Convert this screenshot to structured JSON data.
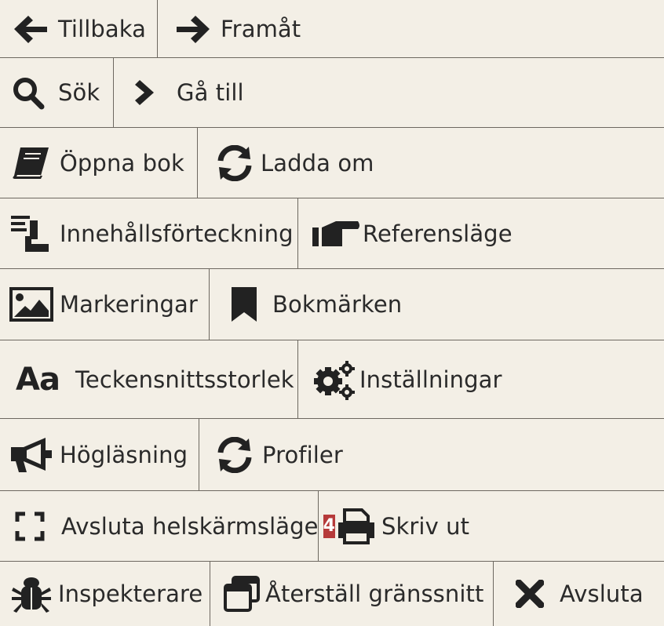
{
  "menu": {
    "back": "Tillbaka",
    "forward": "Framåt",
    "search": "Sök",
    "goto": "Gå till",
    "open_book": "Öppna bok",
    "reload": "Ladda om",
    "toc": "Innehållsförteckning",
    "reference_mode": "Referensläge",
    "highlights": "Markeringar",
    "bookmarks": "Bokmärken",
    "font_size_icon": "Aa",
    "font_size": "Teckensnittsstorlek",
    "settings": "Inställningar",
    "read_aloud": "Högläsning",
    "profiles": "Profiler",
    "exit_fullscreen": "Avsluta helskärmsläge",
    "badge": "4",
    "print": "Skriv ut",
    "inspector": "Inspekterare",
    "reset_interface": "Återställ gränssnitt",
    "quit": "Avsluta"
  },
  "colors": {
    "background": "#f3efe6",
    "border": "#6d6860",
    "icon": "#222222",
    "badge": "#b63a3a"
  }
}
